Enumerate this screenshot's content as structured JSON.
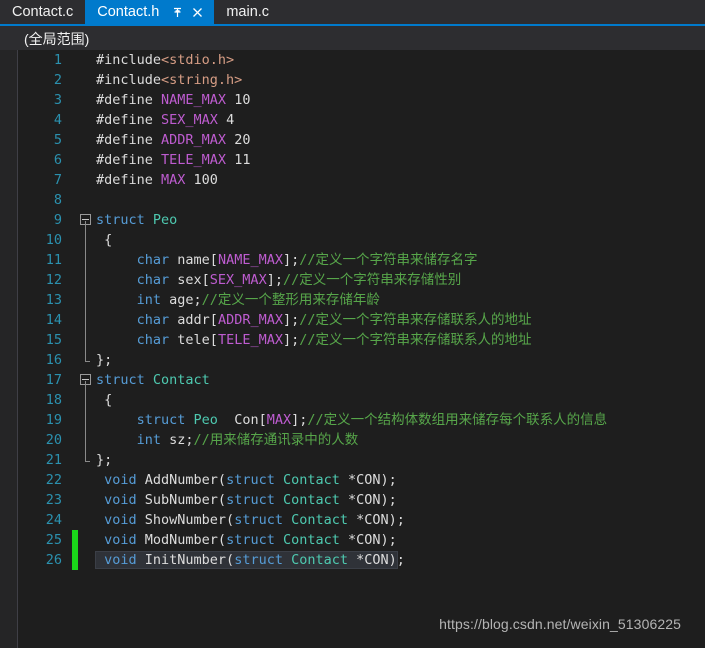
{
  "tabs": [
    {
      "label": "Contact.c",
      "active": false
    },
    {
      "label": "Contact.h",
      "active": true
    },
    {
      "label": "main.c",
      "active": false
    }
  ],
  "tab_icons": {
    "pin": "pin-icon",
    "close": "close-icon"
  },
  "scope": {
    "text": "(全局范围)"
  },
  "watermark": {
    "text": "https://blog.csdn.net/weixin_51306225"
  },
  "colors": {
    "tab_active_bg": "#007acc",
    "chrome_bg": "#2d2d30",
    "editor_bg": "#1e1e1e",
    "linenumber": "#2b91af",
    "keyword": "#569cd6",
    "macro": "#be5cd0",
    "type": "#4ec9b0",
    "comment": "#57a64a",
    "string": "#d69d85",
    "plain": "#dcdcdc",
    "changebar": "#1ad61a",
    "current_line": "#2f3238"
  },
  "code": {
    "lines": [
      {
        "n": "1",
        "fold": "none",
        "changed": false,
        "hl": false,
        "tokens": [
          {
            "t": "#include",
            "c": "plain"
          },
          {
            "t": "<stdio.h>",
            "c": "string"
          }
        ]
      },
      {
        "n": "2",
        "fold": "none",
        "changed": false,
        "hl": false,
        "tokens": [
          {
            "t": "#include",
            "c": "plain"
          },
          {
            "t": "<string.h>",
            "c": "string"
          }
        ]
      },
      {
        "n": "3",
        "fold": "none",
        "changed": false,
        "hl": false,
        "tokens": [
          {
            "t": "#define ",
            "c": "plain"
          },
          {
            "t": "NAME_MAX",
            "c": "macro"
          },
          {
            "t": " 10",
            "c": "plain"
          }
        ]
      },
      {
        "n": "4",
        "fold": "none",
        "changed": false,
        "hl": false,
        "tokens": [
          {
            "t": "#define ",
            "c": "plain"
          },
          {
            "t": "SEX_MAX",
            "c": "macro"
          },
          {
            "t": " 4",
            "c": "plain"
          }
        ]
      },
      {
        "n": "5",
        "fold": "none",
        "changed": false,
        "hl": false,
        "tokens": [
          {
            "t": "#define ",
            "c": "plain"
          },
          {
            "t": "ADDR_MAX",
            "c": "macro"
          },
          {
            "t": " 20",
            "c": "plain"
          }
        ]
      },
      {
        "n": "6",
        "fold": "none",
        "changed": false,
        "hl": false,
        "tokens": [
          {
            "t": "#define ",
            "c": "plain"
          },
          {
            "t": "TELE_MAX",
            "c": "macro"
          },
          {
            "t": " 11",
            "c": "plain"
          }
        ]
      },
      {
        "n": "7",
        "fold": "none",
        "changed": false,
        "hl": false,
        "tokens": [
          {
            "t": "#define ",
            "c": "plain"
          },
          {
            "t": "MAX",
            "c": "macro"
          },
          {
            "t": " 100",
            "c": "plain"
          }
        ]
      },
      {
        "n": "8",
        "fold": "none",
        "changed": false,
        "hl": false,
        "tokens": []
      },
      {
        "n": "9",
        "fold": "box",
        "changed": false,
        "hl": false,
        "tokens": [
          {
            "t": "struct ",
            "c": "kw"
          },
          {
            "t": "Peo",
            "c": "type"
          }
        ]
      },
      {
        "n": "10",
        "fold": "line",
        "changed": false,
        "hl": false,
        "tokens": [
          {
            "t": " {",
            "c": "plain"
          }
        ]
      },
      {
        "n": "11",
        "fold": "line",
        "changed": false,
        "hl": false,
        "tokens": [
          {
            "t": "     ",
            "c": "plain"
          },
          {
            "t": "char",
            "c": "kw"
          },
          {
            "t": " name[",
            "c": "plain"
          },
          {
            "t": "NAME_MAX",
            "c": "macro"
          },
          {
            "t": "];",
            "c": "plain"
          },
          {
            "t": "//定义一个字符串来储存名字",
            "c": "comment"
          }
        ]
      },
      {
        "n": "12",
        "fold": "line",
        "changed": false,
        "hl": false,
        "tokens": [
          {
            "t": "     ",
            "c": "plain"
          },
          {
            "t": "char",
            "c": "kw"
          },
          {
            "t": " sex[",
            "c": "plain"
          },
          {
            "t": "SEX_MAX",
            "c": "macro"
          },
          {
            "t": "];",
            "c": "plain"
          },
          {
            "t": "//定义一个字符串来存储性别",
            "c": "comment"
          }
        ]
      },
      {
        "n": "13",
        "fold": "line",
        "changed": false,
        "hl": false,
        "tokens": [
          {
            "t": "     ",
            "c": "plain"
          },
          {
            "t": "int",
            "c": "kw"
          },
          {
            "t": " age;",
            "c": "plain"
          },
          {
            "t": "//定义一个整形用来存储年龄",
            "c": "comment"
          }
        ]
      },
      {
        "n": "14",
        "fold": "line",
        "changed": false,
        "hl": false,
        "tokens": [
          {
            "t": "     ",
            "c": "plain"
          },
          {
            "t": "char",
            "c": "kw"
          },
          {
            "t": " addr[",
            "c": "plain"
          },
          {
            "t": "ADDR_MAX",
            "c": "macro"
          },
          {
            "t": "];",
            "c": "plain"
          },
          {
            "t": "//定义一个字符串来存储联系人的地址",
            "c": "comment"
          }
        ]
      },
      {
        "n": "15",
        "fold": "line",
        "changed": false,
        "hl": false,
        "tokens": [
          {
            "t": "     ",
            "c": "plain"
          },
          {
            "t": "char",
            "c": "kw"
          },
          {
            "t": " tele[",
            "c": "plain"
          },
          {
            "t": "TELE_MAX",
            "c": "macro"
          },
          {
            "t": "];",
            "c": "plain"
          },
          {
            "t": "//定义一个字符串来存储联系人的地址",
            "c": "comment"
          }
        ]
      },
      {
        "n": "16",
        "fold": "end",
        "changed": false,
        "hl": false,
        "tokens": [
          {
            "t": "};",
            "c": "plain"
          }
        ]
      },
      {
        "n": "17",
        "fold": "box",
        "changed": false,
        "hl": false,
        "tokens": [
          {
            "t": "struct ",
            "c": "kw"
          },
          {
            "t": "Contact",
            "c": "type"
          }
        ]
      },
      {
        "n": "18",
        "fold": "line",
        "changed": false,
        "hl": false,
        "tokens": [
          {
            "t": " {",
            "c": "plain"
          }
        ]
      },
      {
        "n": "19",
        "fold": "line",
        "changed": false,
        "hl": false,
        "tokens": [
          {
            "t": "     ",
            "c": "plain"
          },
          {
            "t": "struct ",
            "c": "kw"
          },
          {
            "t": "Peo",
            "c": "type"
          },
          {
            "t": "  Con[",
            "c": "plain"
          },
          {
            "t": "MAX",
            "c": "macro"
          },
          {
            "t": "];",
            "c": "plain"
          },
          {
            "t": "//定义一个结构体数组用来储存每个联系人的信息",
            "c": "comment"
          }
        ]
      },
      {
        "n": "20",
        "fold": "line",
        "changed": false,
        "hl": false,
        "tokens": [
          {
            "t": "     ",
            "c": "plain"
          },
          {
            "t": "int",
            "c": "kw"
          },
          {
            "t": " sz;",
            "c": "plain"
          },
          {
            "t": "//用来储存通讯录中的人数",
            "c": "comment"
          }
        ]
      },
      {
        "n": "21",
        "fold": "end",
        "changed": false,
        "hl": false,
        "tokens": [
          {
            "t": "};",
            "c": "plain"
          }
        ]
      },
      {
        "n": "22",
        "fold": "none",
        "changed": false,
        "hl": false,
        "tokens": [
          {
            "t": " ",
            "c": "plain"
          },
          {
            "t": "void",
            "c": "kw"
          },
          {
            "t": " AddNumber(",
            "c": "plain"
          },
          {
            "t": "struct ",
            "c": "kw"
          },
          {
            "t": "Contact",
            "c": "type"
          },
          {
            "t": " *CON);",
            "c": "plain"
          }
        ]
      },
      {
        "n": "23",
        "fold": "none",
        "changed": false,
        "hl": false,
        "tokens": [
          {
            "t": " ",
            "c": "plain"
          },
          {
            "t": "void",
            "c": "kw"
          },
          {
            "t": " SubNumber(",
            "c": "plain"
          },
          {
            "t": "struct ",
            "c": "kw"
          },
          {
            "t": "Contact",
            "c": "type"
          },
          {
            "t": " *CON);",
            "c": "plain"
          }
        ]
      },
      {
        "n": "24",
        "fold": "none",
        "changed": false,
        "hl": false,
        "tokens": [
          {
            "t": " ",
            "c": "plain"
          },
          {
            "t": "void",
            "c": "kw"
          },
          {
            "t": " ShowNumber(",
            "c": "plain"
          },
          {
            "t": "struct ",
            "c": "kw"
          },
          {
            "t": "Contact",
            "c": "type"
          },
          {
            "t": " *CON);",
            "c": "plain"
          }
        ]
      },
      {
        "n": "25",
        "fold": "none",
        "changed": true,
        "hl": false,
        "tokens": [
          {
            "t": " ",
            "c": "plain"
          },
          {
            "t": "void",
            "c": "kw"
          },
          {
            "t": " ModNumber(",
            "c": "plain"
          },
          {
            "t": "struct ",
            "c": "kw"
          },
          {
            "t": "Contact",
            "c": "type"
          },
          {
            "t": " *CON);",
            "c": "plain"
          }
        ]
      },
      {
        "n": "26",
        "fold": "none",
        "changed": true,
        "hl": true,
        "tokens": [
          {
            "t": " ",
            "c": "plain"
          },
          {
            "t": "void",
            "c": "kw"
          },
          {
            "t": " InitNumber(",
            "c": "plain"
          },
          {
            "t": "struct ",
            "c": "kw"
          },
          {
            "t": "Contact",
            "c": "type"
          },
          {
            "t": " *CON)",
            "c": "plain"
          },
          {
            "t": ";",
            "c": "plain",
            "outside": true
          }
        ]
      }
    ]
  }
}
